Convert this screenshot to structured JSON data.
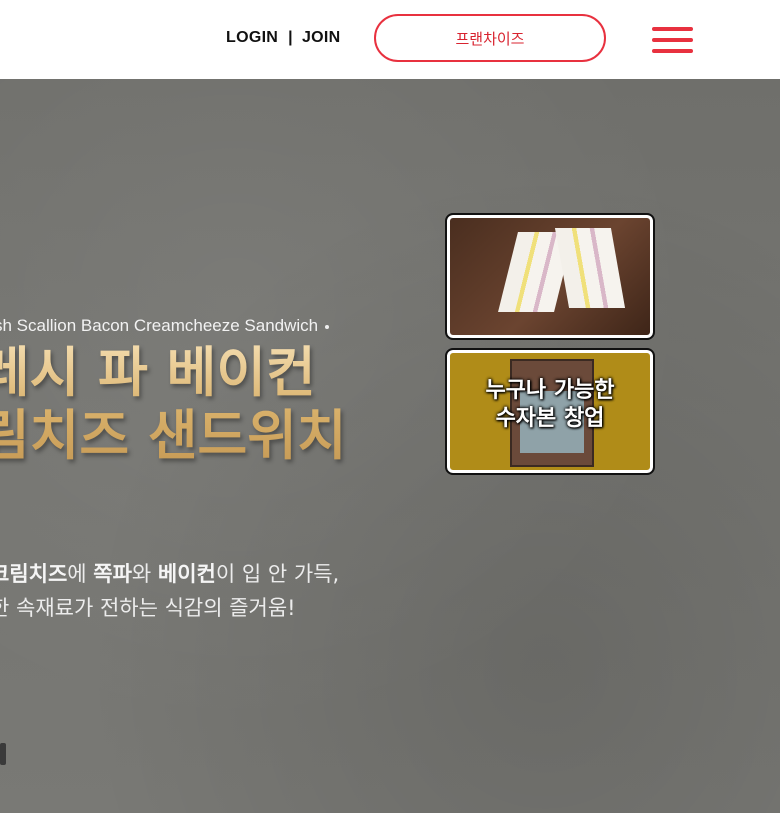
{
  "header": {
    "login": "LOGIN",
    "separator": "|",
    "join": "JOIN",
    "franchise_button": "프랜차이즈",
    "menu_icon": "hamburger-icon",
    "accent_color": "#e8313f"
  },
  "hero": {
    "english_name": "sh Scallion Bacon Creamcheeze Sandwich",
    "title_line1": "레시 파 베이컨",
    "title_line2": "림치즈 샌드위치",
    "desc_line1_part1": "크림치즈",
    "desc_line1_part2": "에 ",
    "desc_line1_part3": "쪽파",
    "desc_line1_part4": "와 ",
    "desc_line1_part5": "베이컨",
    "desc_line1_part6": "이 입 안 가득,",
    "desc_line2": "한 속재료가 전하는 식감의 즐거움!"
  },
  "side_cards": [
    {
      "name": "sandwich-photo",
      "text": ""
    },
    {
      "name": "startup-banner",
      "text_line1": "누구나 가능한",
      "text_line2": "수자본 창업"
    }
  ]
}
